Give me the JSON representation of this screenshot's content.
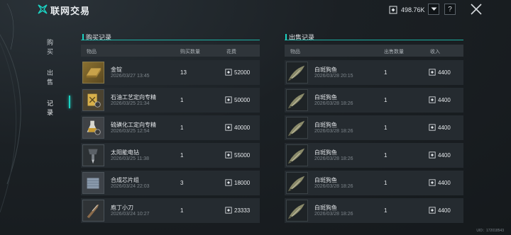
{
  "app": {
    "title": "联网交易"
  },
  "currency": {
    "amount": "498.76K"
  },
  "help_label": "?",
  "nav": {
    "items": [
      {
        "label": "购买"
      },
      {
        "label": "出售"
      },
      {
        "label": "记录"
      }
    ],
    "active": "记录"
  },
  "buy_records": {
    "title": "购买记录",
    "headers": {
      "item": "物品",
      "qty": "购买数量",
      "cost": "花费"
    },
    "rows": [
      {
        "name": "金锭",
        "date": "2026/03/27 13:45",
        "qty": "13",
        "price": "52000",
        "icon": "gold-bar-icon"
      },
      {
        "name": "石油工艺定向专精",
        "date": "2026/03/25 21:34",
        "qty": "1",
        "price": "50000",
        "icon": "oil-blueprint-icon"
      },
      {
        "name": "硫磺化工定向专精",
        "date": "2026/03/25 12:54",
        "qty": "1",
        "price": "40000",
        "icon": "chemical-blueprint-icon"
      },
      {
        "name": "太阳能电钻",
        "date": "2026/03/25 11:38",
        "qty": "1",
        "price": "55000",
        "icon": "solar-drill-icon"
      },
      {
        "name": "合成芯片组",
        "date": "2026/03/24 22:03",
        "qty": "3",
        "price": "18000",
        "icon": "chipset-icon"
      },
      {
        "name": "庖丁小刀",
        "date": "2026/03/24 10:27",
        "qty": "1",
        "price": "23333",
        "icon": "knife-icon"
      }
    ]
  },
  "sell_records": {
    "title": "出售记录",
    "headers": {
      "item": "物品",
      "qty": "出售数量",
      "income": "收入"
    },
    "rows": [
      {
        "name": "白斑狗鱼",
        "date": "2026/03/28 20:15",
        "qty": "1",
        "price": "4400",
        "icon": "pike-fish-icon"
      },
      {
        "name": "白斑狗鱼",
        "date": "2026/03/28 18:26",
        "qty": "1",
        "price": "4400",
        "icon": "pike-fish-icon"
      },
      {
        "name": "白斑狗鱼",
        "date": "2026/03/28 18:26",
        "qty": "1",
        "price": "4400",
        "icon": "pike-fish-icon"
      },
      {
        "name": "白斑狗鱼",
        "date": "2026/03/28 18:26",
        "qty": "1",
        "price": "4400",
        "icon": "pike-fish-icon"
      },
      {
        "name": "白斑狗鱼",
        "date": "2026/03/28 18:26",
        "qty": "1",
        "price": "4400",
        "icon": "pike-fish-icon"
      },
      {
        "name": "白斑狗鱼",
        "date": "2026/03/28 18:26",
        "qty": "1",
        "price": "4400",
        "icon": "pike-fish-icon"
      }
    ]
  },
  "uid": "UID：172018543",
  "colors": {
    "accent": "#1bd3c3",
    "row_bg": "#252b30",
    "header_bg": "#2f353a"
  }
}
